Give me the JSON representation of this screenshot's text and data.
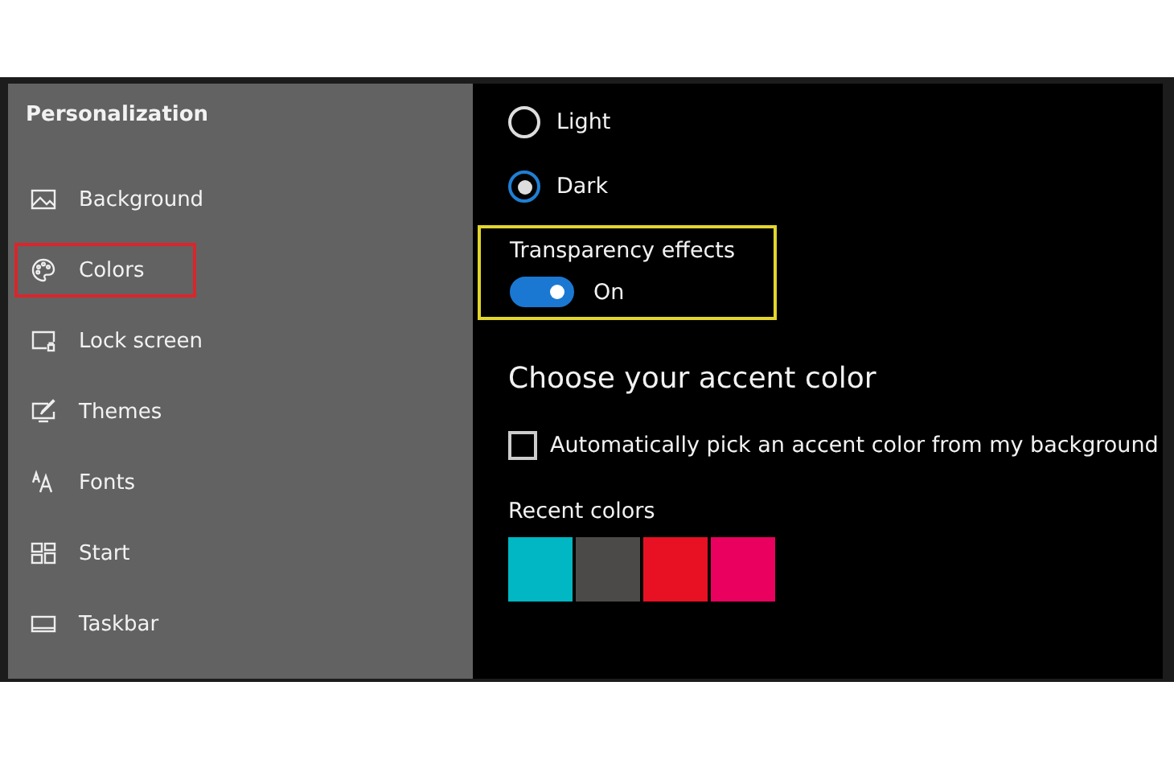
{
  "sidebar": {
    "title": "Personalization",
    "items": [
      {
        "label": "Background",
        "selected": false
      },
      {
        "label": "Colors",
        "selected": true
      },
      {
        "label": "Lock screen",
        "selected": false
      },
      {
        "label": "Themes",
        "selected": false
      },
      {
        "label": "Fonts",
        "selected": false
      },
      {
        "label": "Start",
        "selected": false
      },
      {
        "label": "Taskbar",
        "selected": false
      }
    ]
  },
  "app_mode": {
    "options": [
      {
        "label": "Light",
        "selected": false
      },
      {
        "label": "Dark",
        "selected": true
      }
    ]
  },
  "transparency": {
    "label": "Transparency effects",
    "on": true,
    "state_text": "On",
    "highlighted": true
  },
  "accent": {
    "heading": "Choose your accent color",
    "auto_pick": {
      "label": "Automatically pick an accent color from my background",
      "checked": false
    },
    "recent_label": "Recent colors",
    "recent_colors": [
      {
        "color": "#00b7c3"
      },
      {
        "color": "#4c4a48"
      },
      {
        "color": "#e81123"
      },
      {
        "color": "#ea005e"
      }
    ]
  }
}
